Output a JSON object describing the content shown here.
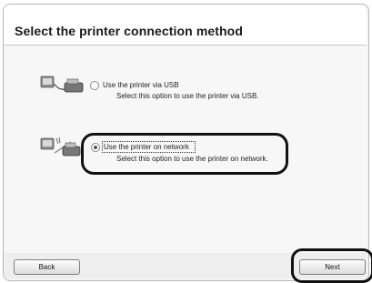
{
  "dialog": {
    "title": "Select the printer connection method"
  },
  "options": [
    {
      "label": "Use the printer via USB",
      "description": "Select this option to use the printer via USB.",
      "selected": false,
      "icon": "usb-printer-icon"
    },
    {
      "label": "Use the printer on network",
      "description": "Select this option to use the printer on network.",
      "selected": true,
      "icon": "network-printer-icon"
    }
  ],
  "buttons": {
    "back": "Back",
    "next": "Next"
  }
}
